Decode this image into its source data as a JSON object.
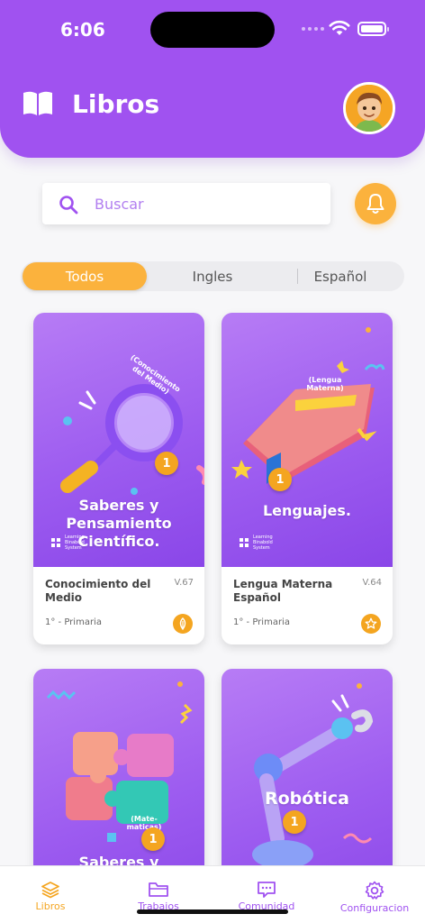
{
  "status_bar": {
    "time": "6:06"
  },
  "header": {
    "title": "Libros"
  },
  "search": {
    "placeholder": "Buscar"
  },
  "tabs": [
    {
      "label": "Todos",
      "active": true
    },
    {
      "label": "Ingles",
      "active": false
    },
    {
      "label": "Español",
      "active": false
    }
  ],
  "books": [
    {
      "cover_title": "Saberes y Pensamiento Científico.",
      "cover_subject": "(Conocimiento del Medio)",
      "cover_grade": "1",
      "cover_logo": "Learning Binabold System",
      "name": "Conocimiento del Medio",
      "version": "V.67",
      "grade": "1° - Primaria",
      "action_icon": "leaf-icon"
    },
    {
      "cover_title": "Lenguajes.",
      "cover_subject": "(Lengua Materna)",
      "cover_grade": "1",
      "cover_logo": "Learning Binabold System",
      "name": "Lengua Materna Español",
      "version": "V.64",
      "grade": "1° - Primaria",
      "action_icon": "star-icon"
    },
    {
      "cover_title": "Saberes y Pensamiento",
      "cover_subject": "(Mate-maticas)",
      "cover_grade": "1"
    },
    {
      "cover_title": "Robótica",
      "cover_grade": "1"
    }
  ],
  "nav": [
    {
      "label": "Libros",
      "icon": "layers-icon",
      "active": true
    },
    {
      "label": "Trabajos",
      "icon": "folder-icon",
      "active": false
    },
    {
      "label": "Comunidad",
      "icon": "chat-icon",
      "active": false
    },
    {
      "label": "Configuracion",
      "icon": "gear-icon",
      "active": false
    }
  ],
  "colors": {
    "primary": "#a052f0",
    "accent": "#fbb23d",
    "background": "#f7f7f9"
  }
}
